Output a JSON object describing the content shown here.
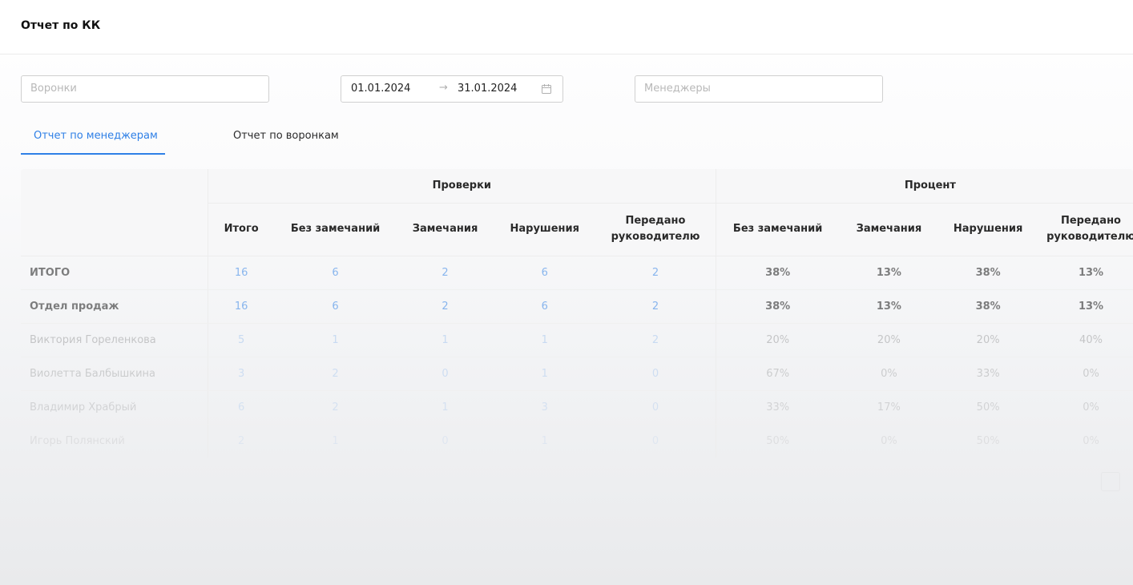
{
  "page": {
    "title": "Отчет по КК"
  },
  "filters": {
    "funnels_placeholder": "Воронки",
    "date_from": "01.01.2024",
    "date_to": "31.01.2024",
    "managers_placeholder": "Менеджеры"
  },
  "tabs": [
    {
      "label": "Отчет по менеджерам",
      "active": true
    },
    {
      "label": "Отчет по воронкам",
      "active": false
    }
  ],
  "table": {
    "groups": {
      "checks": "Проверки",
      "percent": "Процент"
    },
    "columns": [
      "Итого",
      "Без замечаний",
      "Замечания",
      "Нарушения",
      "Передано руководителю",
      "Без замечаний",
      "Замечания",
      "Нарушения",
      "Передано руководителю"
    ],
    "rows": [
      {
        "name": "ИТОГО",
        "values": [
          "16",
          "6",
          "2",
          "6",
          "2",
          "38%",
          "13%",
          "38%",
          "13%"
        ]
      },
      {
        "name": "Отдел продаж",
        "values": [
          "16",
          "6",
          "2",
          "6",
          "2",
          "38%",
          "13%",
          "38%",
          "13%"
        ]
      },
      {
        "name": "Виктория Гореленкова",
        "values": [
          "5",
          "1",
          "1",
          "1",
          "2",
          "20%",
          "20%",
          "20%",
          "40%"
        ]
      },
      {
        "name": "Виолетта Балбышкина",
        "values": [
          "3",
          "2",
          "0",
          "1",
          "0",
          "67%",
          "0%",
          "33%",
          "0%"
        ]
      },
      {
        "name": "Владимир Храбрый",
        "values": [
          "6",
          "2",
          "1",
          "3",
          "0",
          "33%",
          "17%",
          "50%",
          "0%"
        ]
      },
      {
        "name": "Игорь Полянский",
        "values": [
          "2",
          "1",
          "0",
          "1",
          "0",
          "50%",
          "0%",
          "50%",
          "0%"
        ]
      }
    ]
  },
  "colors": {
    "accent": "#2f80e6",
    "header_bg": "#f7f7f8"
  }
}
